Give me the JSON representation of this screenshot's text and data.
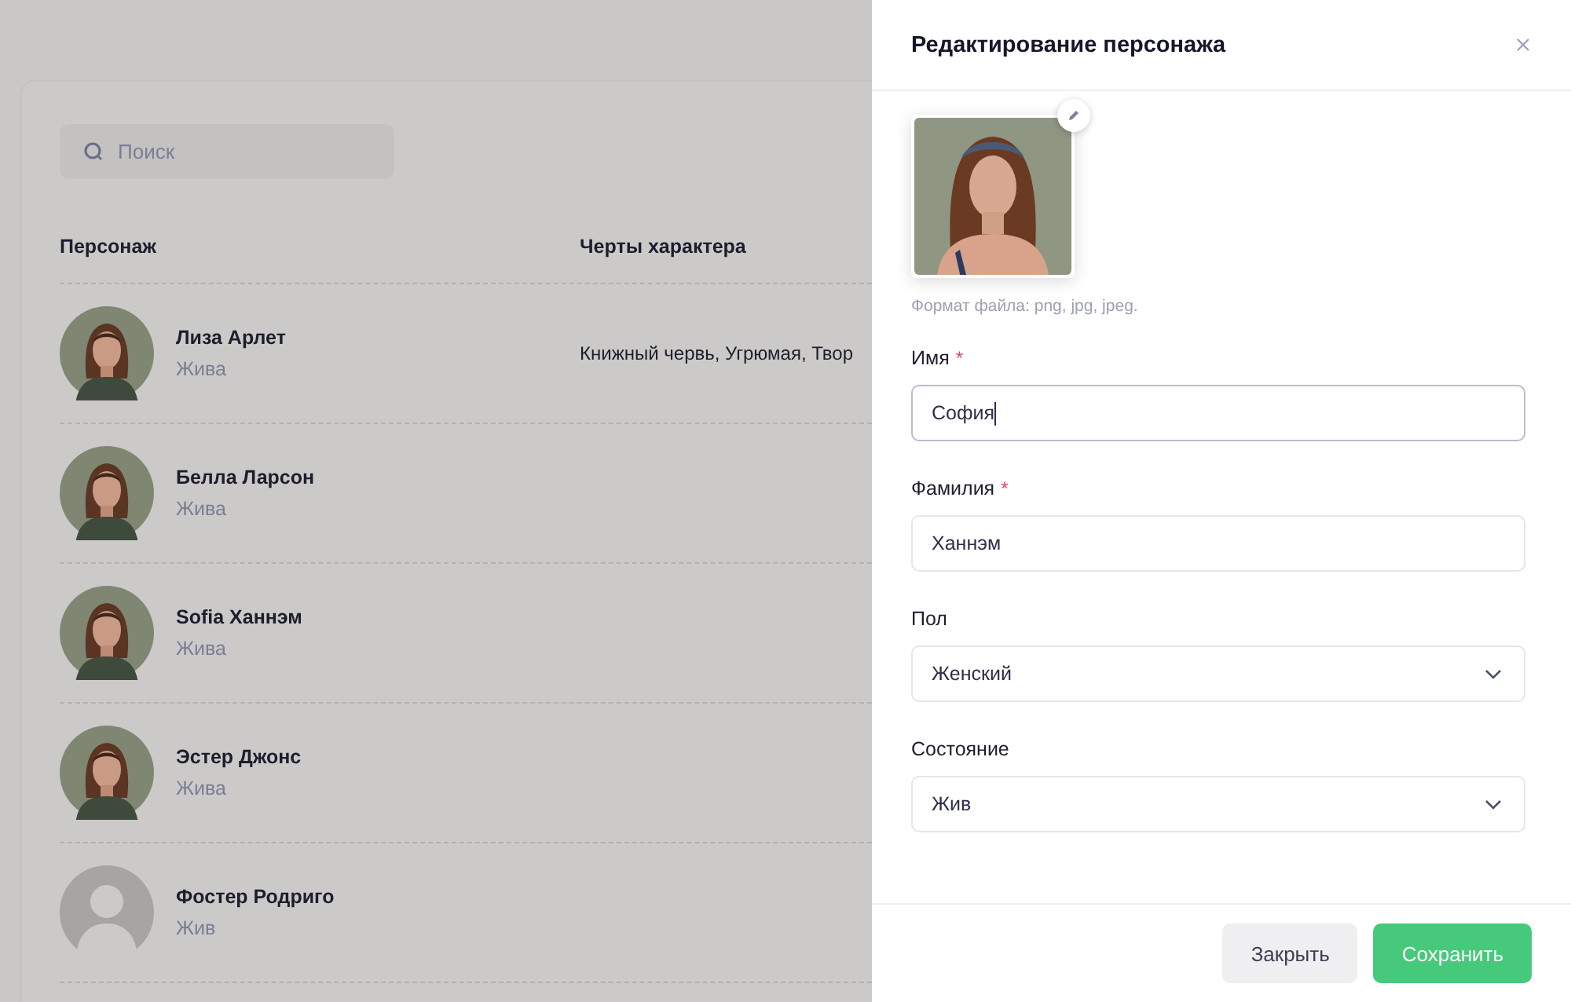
{
  "search": {
    "placeholder": "Поиск"
  },
  "table": {
    "columns": [
      "Персонаж",
      "Черты характера"
    ],
    "rows": [
      {
        "name": "Лиза Арлет",
        "status": "Жива",
        "traits": "Книжный червь, Угрюмая, Твор"
      },
      {
        "name": "Белла Ларсон",
        "status": "Жива"
      },
      {
        "name": "Sofia Ханнэм",
        "status": "Жива"
      },
      {
        "name": "Эстер Джонс",
        "status": "Жива"
      },
      {
        "avatar": {
          "kind": "placeholder"
        },
        "name": "Фостер Родриго",
        "status": "Жив"
      }
    ]
  },
  "drawer": {
    "title": "Редактирование персонажа",
    "photo": {
      "kind": "picture",
      "hint": "Формат файла: png, jpg, jpeg."
    },
    "fields": [
      {
        "kind": "input",
        "label": "Имя",
        "required_mark": "*",
        "value": "София",
        "focused": true
      },
      {
        "kind": "input",
        "label": "Фамилия",
        "required_mark": "*",
        "value": "Ханнэм",
        "focused": false
      },
      {
        "kind": "select",
        "label": "Пол",
        "value": "Женский",
        "focused": false
      },
      {
        "kind": "select",
        "label": "Состояние",
        "value": "Жив",
        "focused": false
      }
    ],
    "buttons": [
      {
        "label": "Закрыть",
        "kind": "secondary"
      },
      {
        "label": "Сохранить",
        "kind": "primary"
      }
    ]
  }
}
